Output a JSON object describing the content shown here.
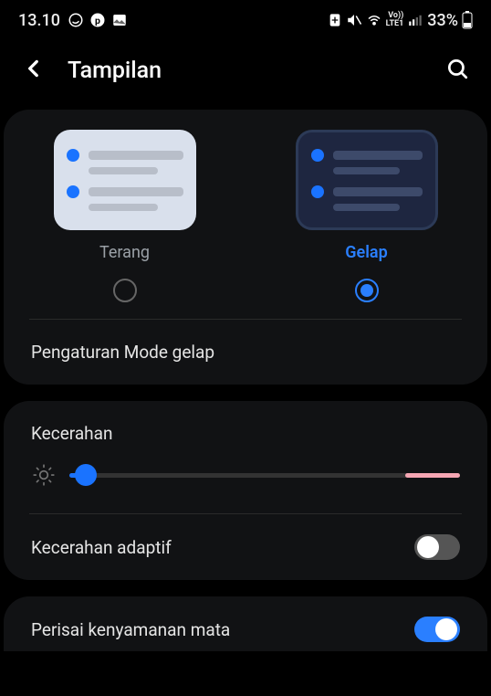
{
  "status": {
    "time": "13.10",
    "battery_text": "33%",
    "network_label": "Vo))\nLTE1"
  },
  "header": {
    "title": "Tampilan"
  },
  "modes": {
    "light_label": "Terang",
    "dark_label": "Gelap",
    "selected": "dark",
    "dark_mode_settings_label": "Pengaturan Mode gelap"
  },
  "brightness": {
    "title": "Kecerahan",
    "adaptive_label": "Kecerahan adaptif",
    "adaptive_on": false
  },
  "eye_comfort": {
    "label": "Perisai kenyamanan mata",
    "on": true
  }
}
